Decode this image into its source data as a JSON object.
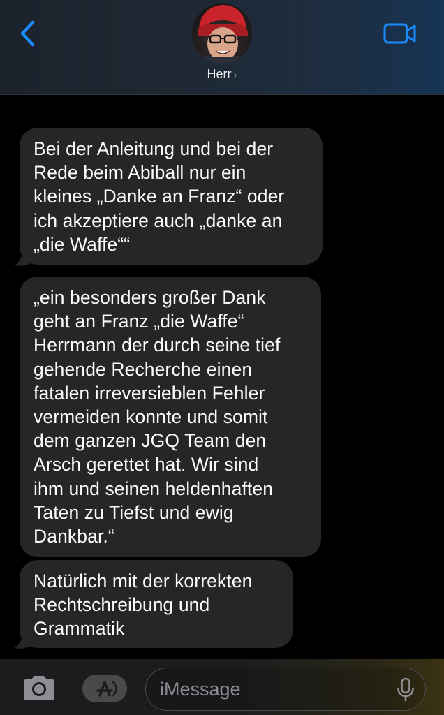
{
  "header": {
    "contact_name": "Herr",
    "chevron": "›",
    "accent_color": "#1a8cff",
    "icons": [
      "back-chevron-icon",
      "video-camera-icon"
    ]
  },
  "messages": [
    {
      "lines": [
        "Bei der Anleitung und bei der",
        "Rede beim Abiball nur ein",
        "kleines „Danke an Franz“ oder",
        "ich akzeptiere auch „danke an",
        "„die Waffe““"
      ]
    },
    {
      "lines": [
        "„ein besonders großer Dank",
        "geht an Franz „die Waffe“",
        "Herrmann der durch seine tief",
        "gehende Recherche einen",
        "fatalen irreversieblen Fehler",
        "vermeiden konnte und somit",
        "dem ganzen JGQ Team den",
        "Arsch gerettet hat. Wir sind",
        "ihm und seinen heldenhaften",
        "Taten zu Tiefst und ewig",
        "Dankbar.“"
      ]
    },
    {
      "lines": [
        "Natürlich mit der korrekten",
        "Rechtschreibung und",
        "Grammatik"
      ]
    }
  ],
  "input_bar": {
    "placeholder": "iMessage",
    "value": "",
    "icons": [
      "camera-icon",
      "app-store-icon",
      "microphone-icon"
    ]
  },
  "colors": {
    "bubble_received": "#262629",
    "background": "#000000"
  }
}
